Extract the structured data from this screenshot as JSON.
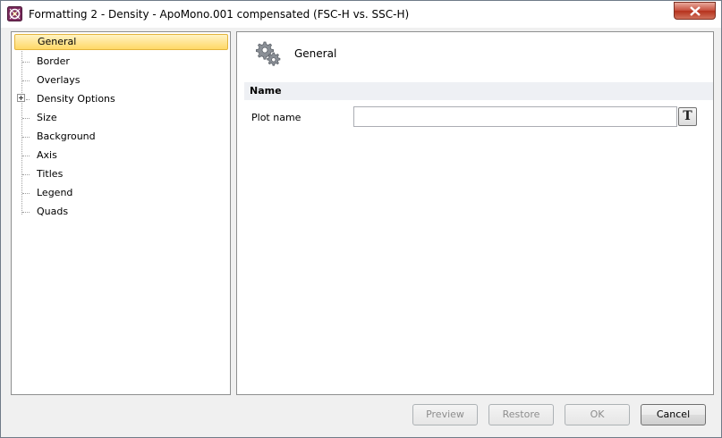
{
  "window": {
    "title": "Formatting 2 - Density - ApoMono.001 compensated (FSC-H vs. SSC-H)",
    "app_icon": "fcs-express-icon",
    "close_icon": "close-icon"
  },
  "tree": {
    "items": [
      {
        "label": "General",
        "selected": true
      },
      {
        "label": "Border"
      },
      {
        "label": "Overlays"
      },
      {
        "label": "Density Options",
        "expandable": true
      },
      {
        "label": "Size"
      },
      {
        "label": "Background"
      },
      {
        "label": "Axis"
      },
      {
        "label": "Titles"
      },
      {
        "label": "Legend"
      },
      {
        "label": "Quads"
      }
    ]
  },
  "content": {
    "section_icon": "gears-icon",
    "section_title": "General",
    "group_header": "Name",
    "fields": [
      {
        "label": "Plot name",
        "value": "",
        "button_icon": "text-format-icon",
        "button_label": "T"
      }
    ]
  },
  "footer": {
    "preview": "Preview",
    "restore": "Restore",
    "ok": "OK",
    "cancel": "Cancel"
  },
  "colors": {
    "selection_bg": "#ffd866",
    "close_button": "#c7513f"
  }
}
